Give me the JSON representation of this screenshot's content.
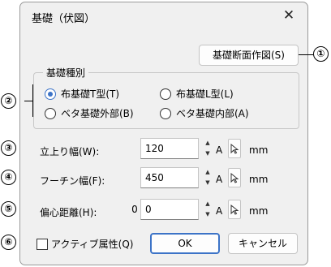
{
  "dialog": {
    "title": "基礎（伏図）"
  },
  "buttons": {
    "section": "基礎断面作図(S)",
    "ok": "OK",
    "cancel": "キャンセル"
  },
  "group": {
    "label": "基礎種別",
    "options": [
      {
        "label": "布基礎T型(T)",
        "checked": true
      },
      {
        "label": "布基礎L型(L)",
        "checked": false
      },
      {
        "label": "ベタ基礎外部(B)",
        "checked": false
      },
      {
        "label": "ベタ基礎内部(A)",
        "checked": false
      }
    ]
  },
  "fields": {
    "rise": {
      "label": "立上り幅(W):",
      "value": "120"
    },
    "footing": {
      "label": "フーチン幅(F):",
      "value": "450"
    },
    "eccentric": {
      "label": "偏心距離(H):",
      "prefix": "0",
      "value": "0"
    }
  },
  "common": {
    "auto": "A",
    "unit": "mm"
  },
  "checkbox": {
    "label": "アクティブ属性(Q)",
    "checked": false
  },
  "callouts": [
    "①",
    "②",
    "③",
    "④",
    "⑤",
    "⑥"
  ]
}
